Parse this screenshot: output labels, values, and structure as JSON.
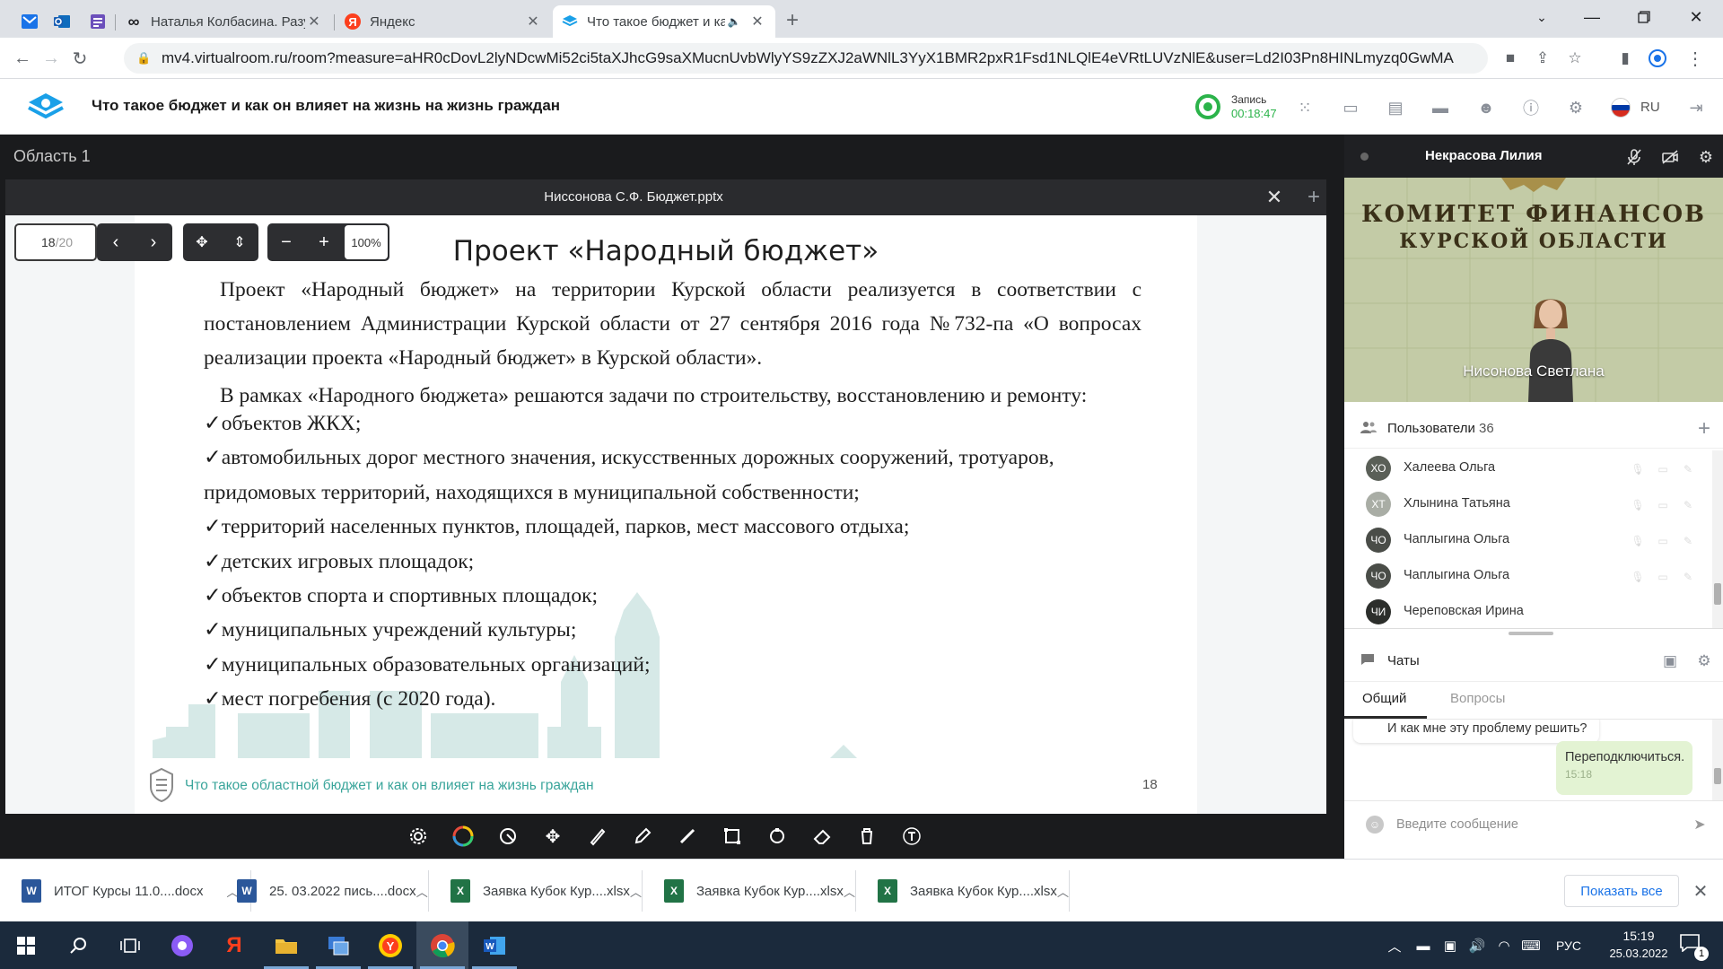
{
  "browser": {
    "tabs": [
      {
        "title": "Наталья Колбасина. Разумное п",
        "icon": "infinity-icon"
      },
      {
        "title": "Яндекс",
        "icon": "yandex-icon"
      },
      {
        "title": "Что такое бюджет и как он",
        "icon": "virtualroom-icon",
        "active": true
      }
    ],
    "url": "mv4.virtualroom.ru/room?measure=aHR0cDovL2lyNDcwMi52ci5taXJhcG9saXMucnUvbWlyYS9zZXJ2aWNlL3YyX1BMR2pxR1Fsd1NLQlE4eVRtLUVzNlE&user=Ld2I03Pn8HINLmyzq0GwMA"
  },
  "room": {
    "title": "Что такое бюджет и как он влияет на жизнь на жизнь граждан",
    "record_label": "Запись",
    "record_time": "00:18:47",
    "lang": "RU",
    "accent": "#2bb34a"
  },
  "main": {
    "area_label": "Область 1",
    "document_name": "Ниссонова С.Ф. Бюджет.pptx",
    "page_current": "18",
    "page_total": "/20",
    "zoom": "100%"
  },
  "slide": {
    "title": "Проект «Народный бюджет»",
    "paragraph1": "Проект «Народный бюджет» на территории Курской области реализуется в соответствии с постановлением Администрации Курской области от 27 сентября 2016 года №732-па «О вопросах реализации проекта «Народный бюджет» в Курской области».",
    "paragraph2": "В рамках «Народного бюджета» решаются задачи по строительству, восстановлению и ремонту:",
    "bullets": [
      "✓объектов ЖКХ;",
      "✓автомобильных дорог местного значения, искусственных дорожных сооружений, тротуаров,",
      "придомовых территорий, находящихся в муниципальной собственности;",
      "✓территорий населенных пунктов, площадей, парков, мест массового отдыха;",
      "✓детских игровых площадок;",
      "✓объектов спорта и спортивных площадок;",
      "✓муниципальных учреждений культуры;",
      "✓муниципальных образовательных организаций;",
      "✓мест погребения (с 2020 года)."
    ],
    "footer_text": "Что такое областной бюджет и как он влияет на жизнь граждан",
    "page_number": "18",
    "footer_color": "#3aa59b"
  },
  "video": {
    "presenter": "Некрасова Лилия",
    "wall_line1": "КОМИТЕТ ФИНАНСОВ",
    "wall_line2": "КУРСКОЙ ОБЛАСТИ",
    "caption": "Нисонова Светлана"
  },
  "users": {
    "label": "Пользователи",
    "count": "36",
    "list": [
      {
        "initials": "ХО",
        "name": "Халеева Ольга",
        "color": "#5a5f57"
      },
      {
        "initials": "ХТ",
        "name": "Хлынина Татьяна",
        "color": "#a9ada5"
      },
      {
        "initials": "ЧО",
        "name": "Чаплыгина Ольга",
        "color": "#4a4d48"
      },
      {
        "initials": "ЧО",
        "name": "Чаплыгина Ольга",
        "color": "#4a4d48"
      },
      {
        "initials": "ЧИ",
        "name": "Череповская Ирина",
        "color": "#2c2e2b"
      }
    ]
  },
  "chat": {
    "label": "Чаты",
    "tab_general": "Общий",
    "tab_questions": "Вопросы",
    "msg_in": "И как мне эту проблему решить?",
    "msg_out": "Переподключиться.",
    "msg_out_time": "15:18",
    "input_placeholder": "Введите сообщение"
  },
  "downloads": {
    "items": [
      {
        "name": "ИТОГ Курсы 11.0....docx",
        "type": "word"
      },
      {
        "name": "25. 03.2022 пись....docx",
        "type": "word"
      },
      {
        "name": "Заявка Кубок Кур....xlsx",
        "type": "excel"
      },
      {
        "name": "Заявка Кубок Кур....xlsx",
        "type": "excel"
      },
      {
        "name": "Заявка Кубок Кур....xlsx",
        "type": "excel"
      }
    ],
    "show_all": "Показать все"
  },
  "taskbar": {
    "lang": "РУС",
    "time": "15:19",
    "date": "25.03.2022",
    "notifications": "1"
  }
}
